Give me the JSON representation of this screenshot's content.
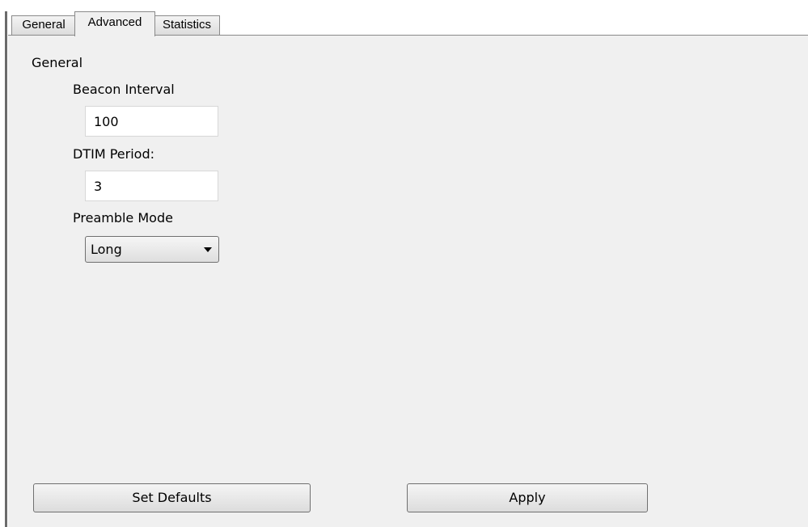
{
  "tabs": [
    {
      "label": "General",
      "active": false
    },
    {
      "label": "Advanced",
      "active": true
    },
    {
      "label": "Statistics",
      "active": false
    }
  ],
  "panel": {
    "group_label": "General",
    "beacon_interval": {
      "label": "Beacon Interval",
      "value": "100"
    },
    "dtim_period": {
      "label": "DTIM Period:",
      "value": "3"
    },
    "preamble_mode": {
      "label": "Preamble Mode",
      "selected": "Long"
    }
  },
  "buttons": {
    "set_defaults": "Set Defaults",
    "apply": "Apply"
  },
  "icons": {
    "dropdown": "chevron-down-icon"
  }
}
